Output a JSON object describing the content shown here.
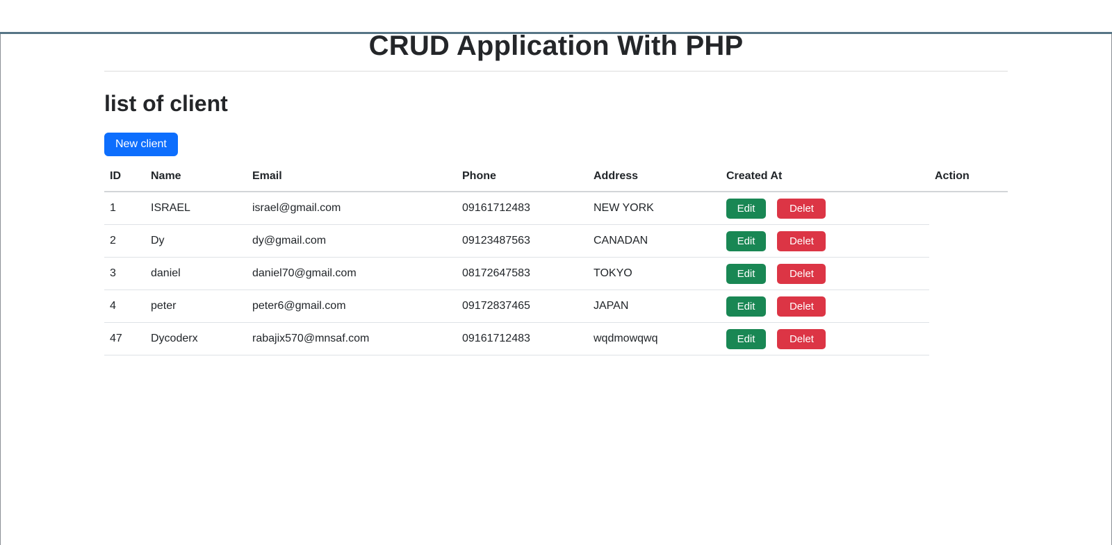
{
  "app": {
    "title": "CRUD Application With PHP",
    "section_title": "list of client",
    "new_client_label": "New client"
  },
  "table": {
    "headers": [
      "ID",
      "Name",
      "Email",
      "Phone",
      "Address",
      "Created At",
      "Action"
    ],
    "actions": {
      "edit": "Edit",
      "delete": "Delet"
    },
    "rows": [
      {
        "id": "1",
        "name": "ISRAEL",
        "email": "israel@gmail.com",
        "phone": "09161712483",
        "address": "NEW YORK"
      },
      {
        "id": "2",
        "name": "Dy",
        "email": "dy@gmail.com",
        "phone": "09123487563",
        "address": "CANADAN"
      },
      {
        "id": "3",
        "name": "daniel",
        "email": "daniel70@gmail.com",
        "phone": "08172647583",
        "address": "TOKYO"
      },
      {
        "id": "4",
        "name": "peter",
        "email": "peter6@gmail.com",
        "phone": "09172837465",
        "address": "JAPAN"
      },
      {
        "id": "47",
        "name": "Dycoderx",
        "email": "rabajix570@mnsaf.com",
        "phone": "09161712483",
        "address": "wqdmowqwq"
      }
    ]
  },
  "colors": {
    "primary": "#0d6efd",
    "success": "#198754",
    "danger": "#dc3545",
    "top_accent": "#567586",
    "table_border": "#dee2e6"
  }
}
